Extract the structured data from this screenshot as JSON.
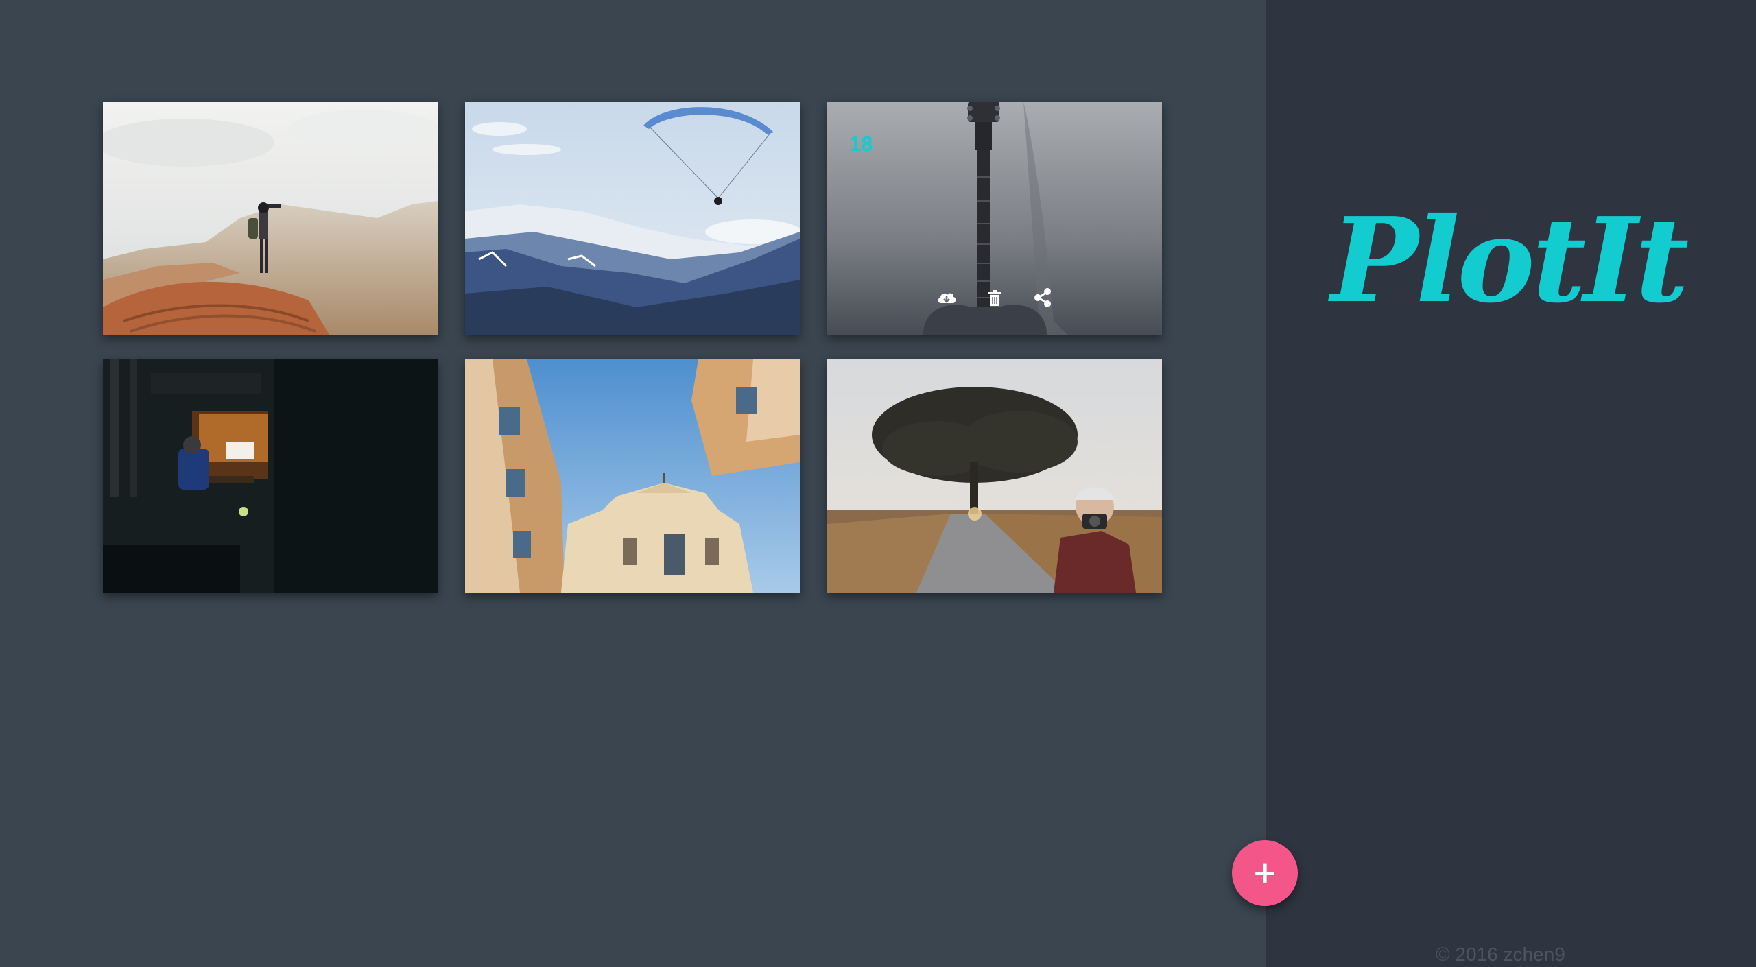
{
  "app": {
    "logo_text": "PlotIt",
    "copyright": "© 2016 zchen9",
    "accent_color": "#12ccd0",
    "fab_color": "#f5568a"
  },
  "gallery": {
    "photos": [
      {
        "subject": "hiker-on-canyon-rock"
      },
      {
        "subject": "paraglider-over-snowy-mountains"
      },
      {
        "subject": "guitar-neck",
        "count": "18",
        "actions": [
          "download-icon",
          "trash-icon",
          "share-icon"
        ]
      },
      {
        "subject": "organist-in-dark-church"
      },
      {
        "subject": "church-facade-between-buildings"
      },
      {
        "subject": "photographer-under-tree-on-road"
      }
    ]
  },
  "fab": {
    "label": "+"
  }
}
